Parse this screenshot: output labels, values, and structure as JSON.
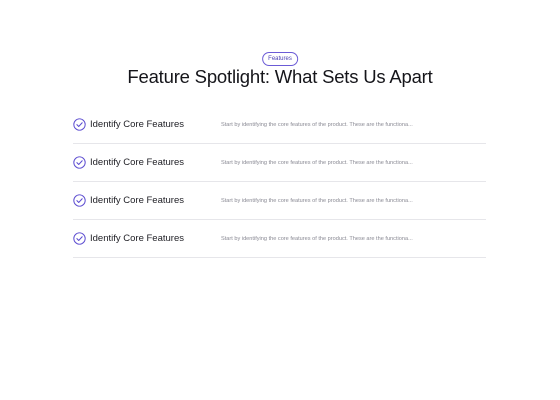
{
  "section": {
    "badge": "Features",
    "title": "Feature Spotlight: What Sets Us Apart"
  },
  "features": [
    {
      "title": "Identify Core Features",
      "description": "Start by identifying the core features of the product. These are the functiona..."
    },
    {
      "title": "Identify Core Features",
      "description": "Start by identifying the core features of the product. These are the functiona..."
    },
    {
      "title": "Identify Core Features",
      "description": "Start by identifying the core features of the product. These are the functiona..."
    },
    {
      "title": "Identify Core Features",
      "description": "Start by identifying the core features of the product. These are the functiona..."
    }
  ],
  "colors": {
    "accent": "#5b4bd0",
    "divider": "#e6e6ea",
    "muted_text": "#8a8a94"
  },
  "icons": {
    "row_icon": "check-circle-icon"
  }
}
